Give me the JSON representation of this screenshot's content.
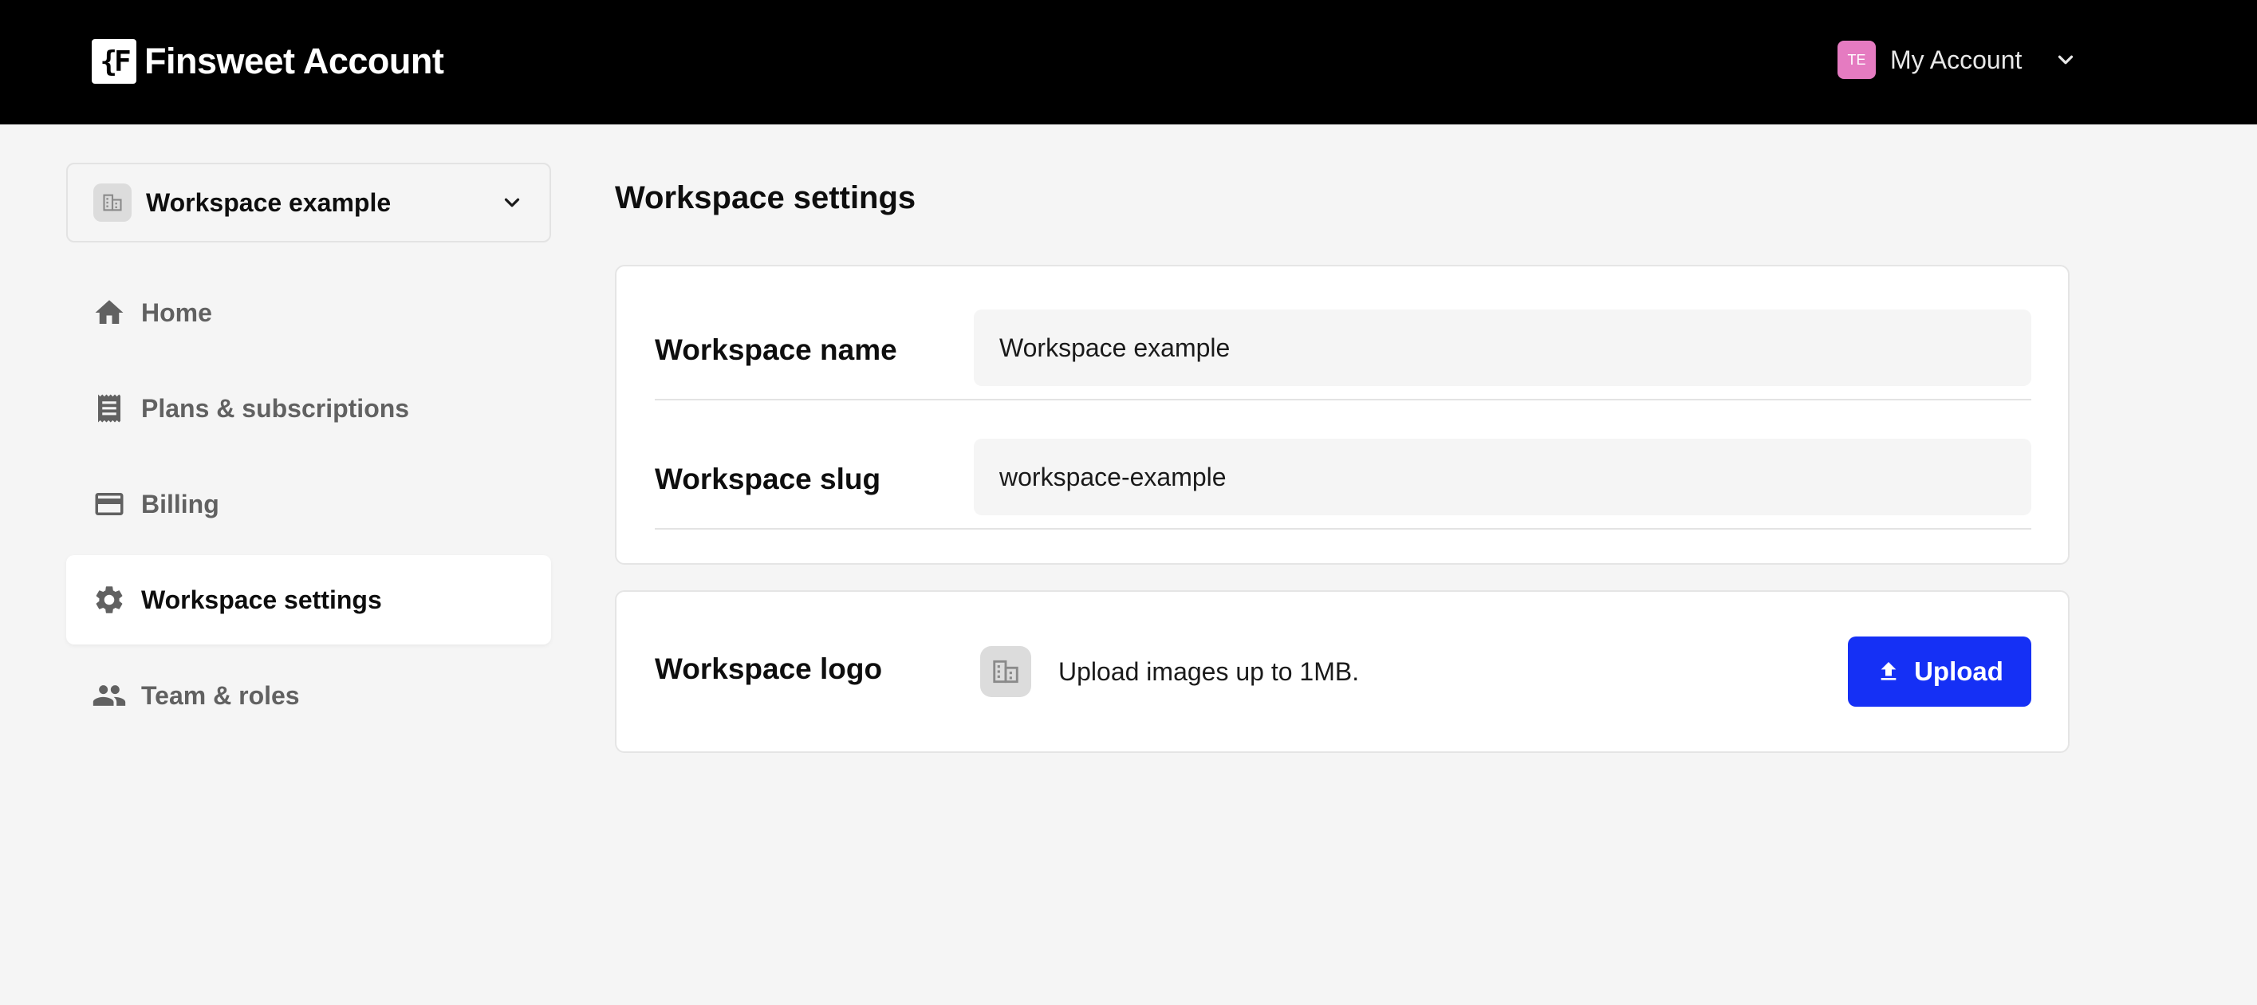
{
  "header": {
    "brand_mark": "{F",
    "brand_name": "Finsweet Account",
    "account": {
      "avatar_initials": "TE",
      "label": "My Account",
      "avatar_color": "#e57bc1"
    }
  },
  "sidebar": {
    "workspace_switcher": {
      "name": "Workspace example"
    },
    "items": [
      {
        "label": "Home",
        "icon": "home-icon",
        "active": false
      },
      {
        "label": "Plans & subscriptions",
        "icon": "receipt-icon",
        "active": false
      },
      {
        "label": "Billing",
        "icon": "credit-card-icon",
        "active": false
      },
      {
        "label": "Workspace settings",
        "icon": "gear-icon",
        "active": true
      },
      {
        "label": "Team & roles",
        "icon": "people-icon",
        "active": false
      }
    ]
  },
  "main": {
    "title": "Workspace settings",
    "fields": {
      "name": {
        "label": "Workspace name",
        "value": "Workspace example"
      },
      "slug": {
        "label": "Workspace slug",
        "value": "workspace-example"
      }
    },
    "logo": {
      "label": "Workspace logo",
      "hint": "Upload images up to 1MB.",
      "upload_label": "Upload"
    }
  },
  "colors": {
    "accent": "#1530f5",
    "topbar": "#000000",
    "background": "#f5f5f5"
  }
}
